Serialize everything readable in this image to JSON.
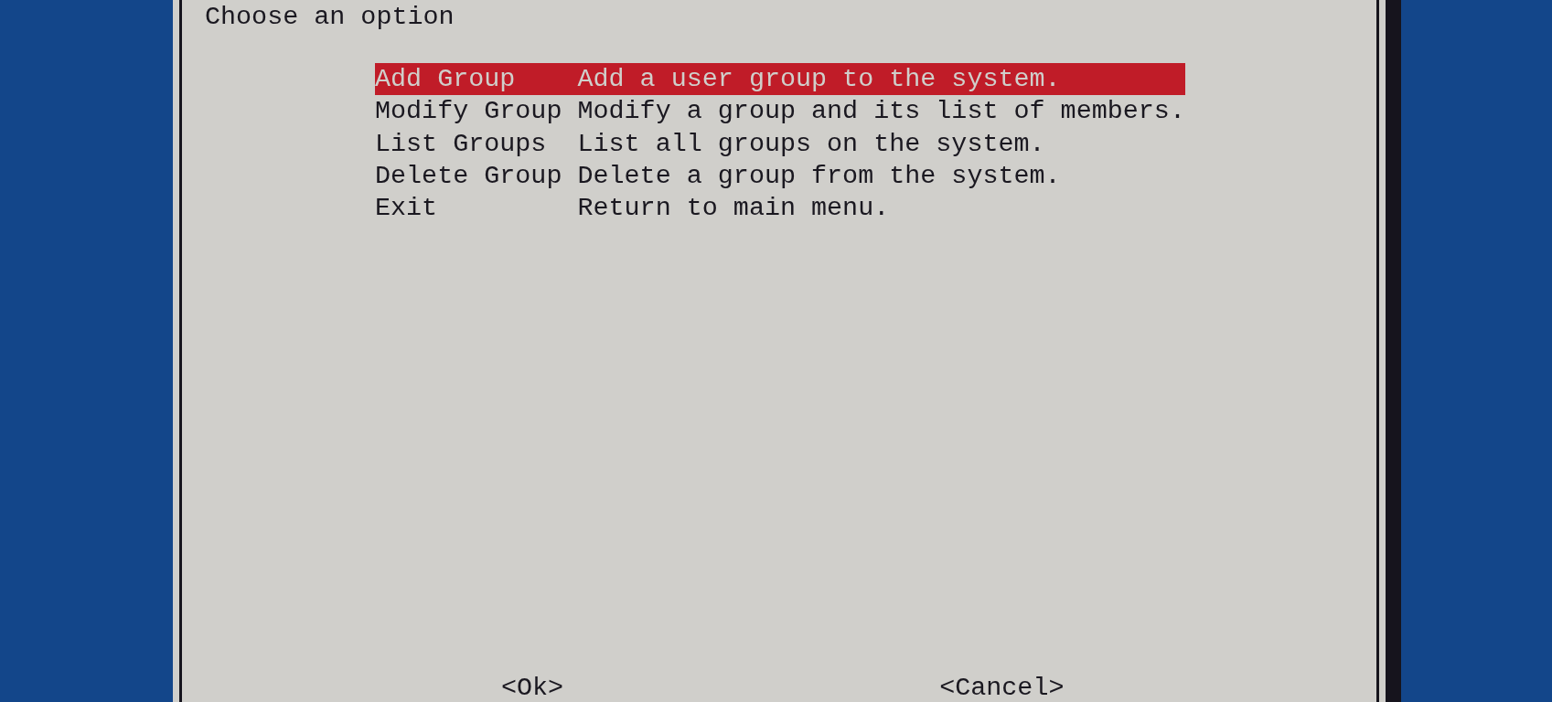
{
  "dialog": {
    "prompt": "Choose an option",
    "menu": [
      {
        "label": "Add Group",
        "description": "Add a user group to the system.",
        "selected": true
      },
      {
        "label": "Modify Group",
        "description": "Modify a group and its list of members.",
        "selected": false
      },
      {
        "label": "List Groups",
        "description": "List all groups on the system.",
        "selected": false
      },
      {
        "label": "Delete Group",
        "description": "Delete a group from the system.",
        "selected": false
      },
      {
        "label": "Exit",
        "description": "Return to main menu.",
        "selected": false
      }
    ],
    "buttons": [
      "<Ok>",
      "<Cancel>"
    ]
  }
}
